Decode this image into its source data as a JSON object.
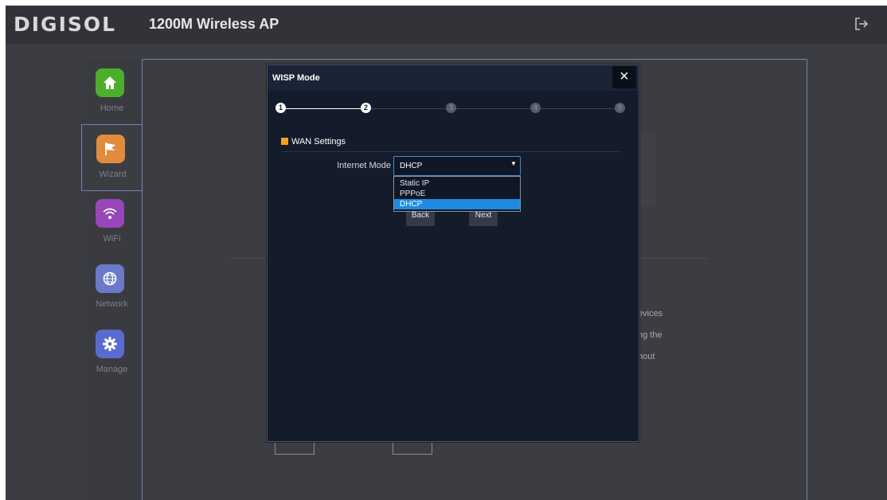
{
  "header": {
    "logo_text": "DIGISOL",
    "title": "1200M Wireless AP",
    "logout_icon": "logout-icon"
  },
  "sidebar": {
    "items": [
      {
        "label": "Home",
        "icon": "home-icon",
        "color": "#4caf2c"
      },
      {
        "label": "Wizard",
        "icon": "flag-icon",
        "color": "#e08c3c"
      },
      {
        "label": "WiFi",
        "icon": "wifi-icon",
        "color": "#9747b8"
      },
      {
        "label": "Network",
        "icon": "globe-icon",
        "color": "#6a79c8"
      },
      {
        "label": "Manage",
        "icon": "gear-icon",
        "color": "#5a6bd0"
      }
    ]
  },
  "background_content": {
    "text_fragments": [
      "evices",
      "ng the",
      "hout"
    ]
  },
  "modal": {
    "title": "WISP Mode",
    "close_label": "×",
    "stepper": {
      "steps": [
        "1",
        "2",
        "3",
        "4",
        "5"
      ],
      "current": 2
    },
    "section_title": "WAN Settings",
    "internet_mode": {
      "label": "Internet Mode",
      "selected": "DHCP",
      "options": [
        "Static IP",
        "PPPoE",
        "DHCP"
      ]
    },
    "back_label": "Back",
    "next_label": "Next"
  },
  "colors": {
    "accent": "#1e8be0",
    "section_marker": "#f2a31b",
    "modal_bg": "#141c2c"
  }
}
